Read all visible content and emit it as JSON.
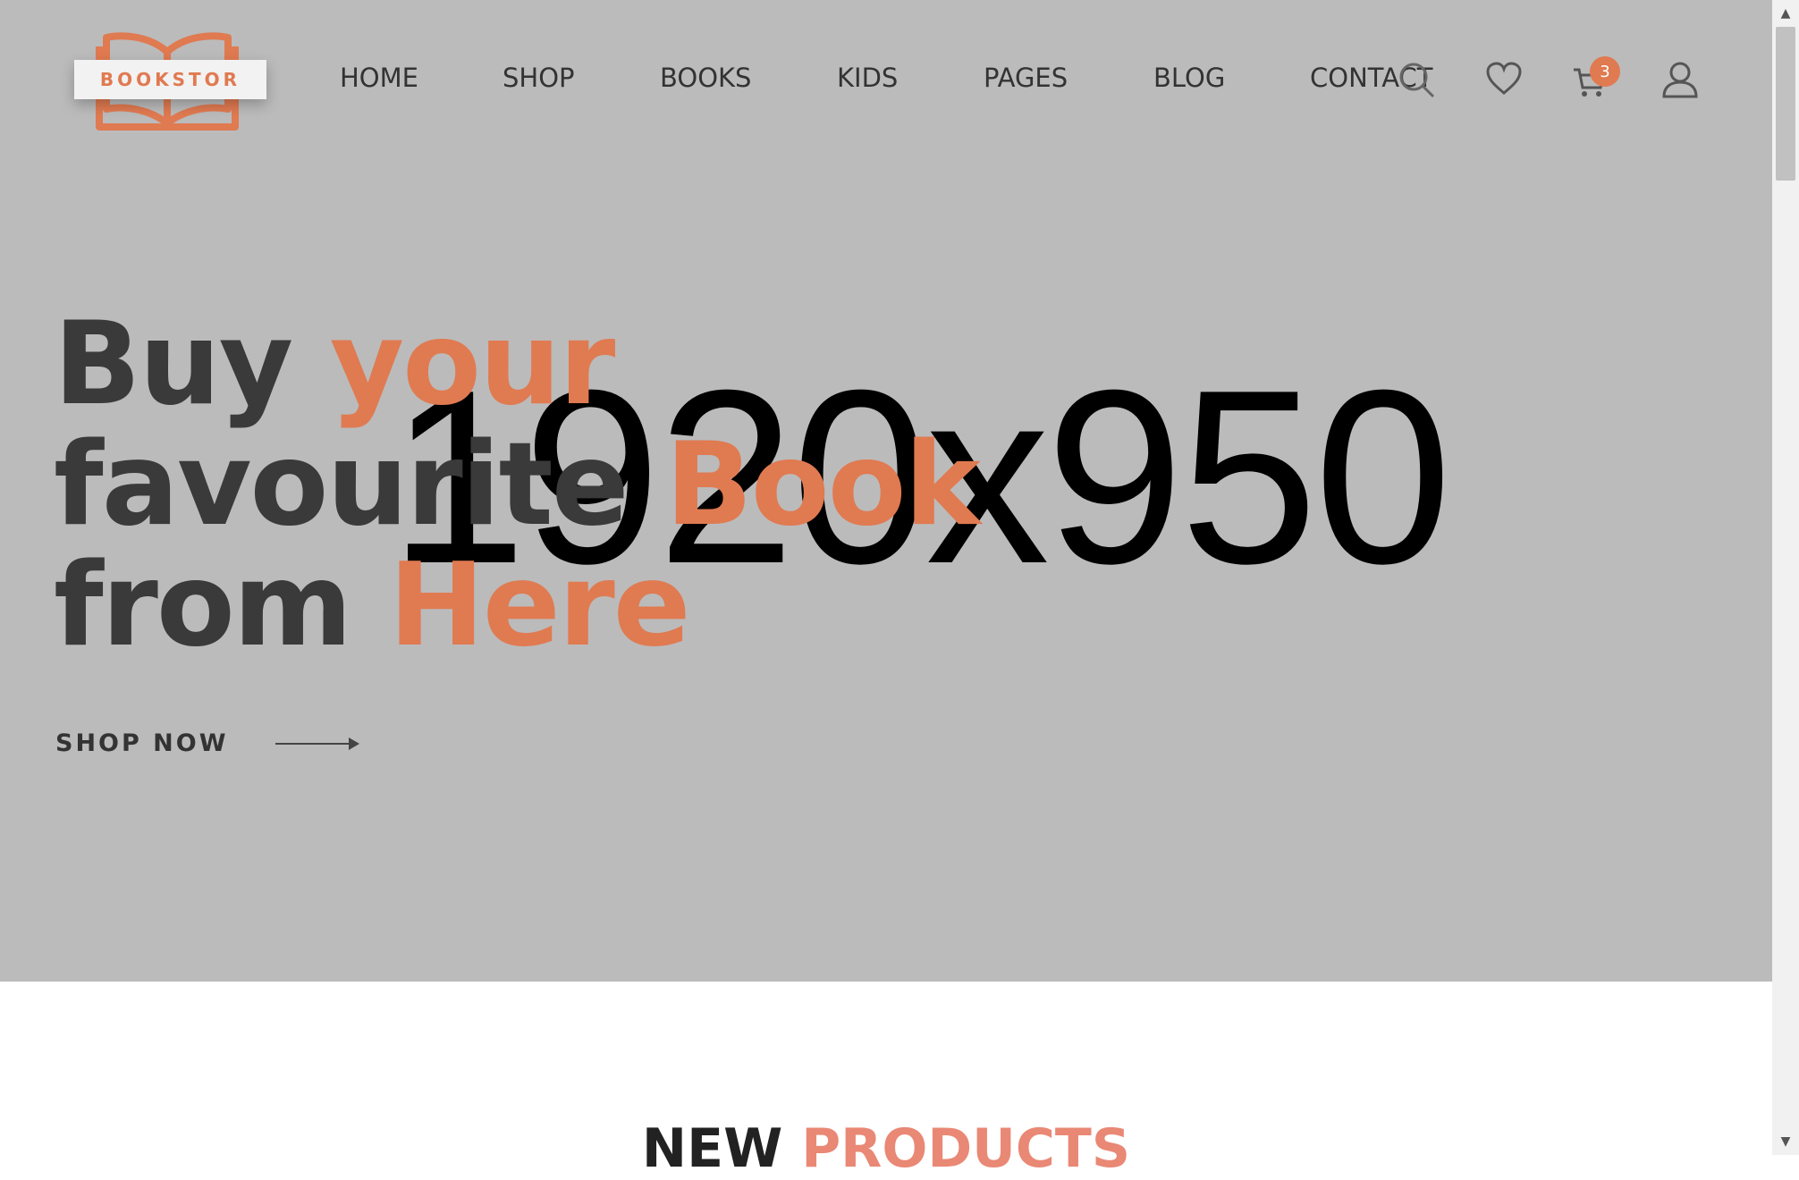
{
  "logo": {
    "text": "BOOKSTOR",
    "icon": "open-book-icon"
  },
  "nav": {
    "items": [
      {
        "label": "HOME"
      },
      {
        "label": "SHOP"
      },
      {
        "label": "BOOKS"
      },
      {
        "label": "KIDS"
      },
      {
        "label": "PAGES"
      },
      {
        "label": "BLOG"
      },
      {
        "label": "CONTACT"
      }
    ]
  },
  "header_icons": {
    "search": "search-icon",
    "wishlist": "heart-icon",
    "cart": "cart-icon",
    "cart_count": "3",
    "account": "user-icon"
  },
  "hero": {
    "placeholder": "1920x950",
    "line1_a": "Buy ",
    "line1_b": "your",
    "line2_a": "favourite ",
    "line2_b": "Book",
    "line3_a": "from ",
    "line3_b": "Here",
    "cta_label": "SHOP NOW",
    "cta_icon": "arrow-right-icon"
  },
  "section": {
    "title_a": "NEW ",
    "title_b": "PRODUCTS"
  },
  "colors": {
    "accent": "#e07a51",
    "hero_bg": "#bbbbbb",
    "text": "#3a3a3a"
  }
}
